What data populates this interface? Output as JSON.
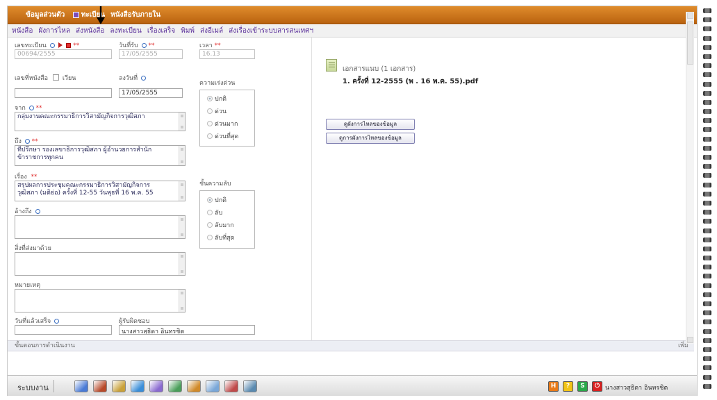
{
  "titlebar": {
    "part1": "ข้อมูลส่วนตัว",
    "part2": "ทะเบียน",
    "part3": "หนังสือรับภายใน"
  },
  "menu": [
    "หนังสือ",
    "ผังการไหล",
    "ส่งหนังสือ",
    "ลงทะเบียน",
    "เรื่องเสร็จ",
    "พิมพ์",
    "ส่งอีเมล์",
    "ส่งเรื่องเข้าระบบสารสนเทศฯ"
  ],
  "form": {
    "reg_no_label": "เลขทะเบียน",
    "reg_no_value": "00694/2555",
    "recv_date_label": "วันที่รับ",
    "recv_date_value": "17/05/2555",
    "time_label": "เวลา",
    "time_value": "16.13",
    "doc_no_label": "เลขที่หนังสือ",
    "circular_label": "เวียน",
    "date_label": "ลงวันที่",
    "date_value": "17/05/2555",
    "doc_no_value": "",
    "from_label": "จาก",
    "from_value": "กลุ่มงานคณะกรรมาธิการวิสามัญกิจการวุฒิสภา",
    "to_label": "ถึง",
    "to_line1": "ที่ปรึกษา รองเลขาธิการวุฒิสภา ผู้อำนวยการสำนัก",
    "to_line2": "ข้าราชการทุกคน",
    "subject_label": "เรื่อง",
    "subject_line1": "สรุปผลการประชุมคณะกรรมาธิการวิสามัญกิจการ",
    "subject_line2": "วุฒิสภา (มติย่อ) ครั้งที่ 12-55 วันพุธที่ 16 พ.ค. 55",
    "ref_label": "อ้างถึง",
    "enclosure_label": "สิ่งที่ส่งมาด้วย",
    "note_label": "หมายเหตุ",
    "done_date_label": "วันที่แล้วเสร็จ",
    "owner_label": "ผู้รับผิดชอบ",
    "owner_value": "นางสาวสุธิดา อินทรชิต"
  },
  "urgency": {
    "label": "ความเร่งด่วน",
    "options": [
      "ปกติ",
      "ด่วน",
      "ด่วนมาก",
      "ด่วนที่สุด"
    ],
    "selected": "ปกติ"
  },
  "secrecy": {
    "label": "ชั้นความลับ",
    "options": [
      "ปกติ",
      "ลับ",
      "ลับมาก",
      "ลับที่สุด"
    ],
    "selected": "ปกติ"
  },
  "attachments": {
    "header": "เอกสารแนบ (1 เอกสาร)",
    "file": "1. ครั้งที่ 12-2555 (พ . 16 พ.ค. 55).pdf"
  },
  "buttons": {
    "flow_view": "ดูผังการไหลของข้อมูล",
    "flow_print": "ดูการผังการไหลของข้อมูล"
  },
  "stepbar": {
    "label": "ขั้นตอนการดำเนินงาน",
    "add": "เพิ่ม"
  },
  "taskbar": {
    "system_label": "ระบบงาน",
    "user": "นางสาวสุธิดา อินทรชิต",
    "icons": [
      "edit-doc-icon",
      "books-icon",
      "pencil-book-icon",
      "doc-stack-icon",
      "printer-icon",
      "mail-send-icon",
      "people-search-icon",
      "checklist-icon",
      "users-icon",
      "user-profile-icon"
    ],
    "tray": [
      {
        "name": "settings-tray-icon",
        "glyph": "H",
        "color": "#e87a1a"
      },
      {
        "name": "help-tray-icon",
        "glyph": "?",
        "color": "#f2c416"
      },
      {
        "name": "switch-tray-icon",
        "glyph": "S",
        "color": "#2aa84a"
      },
      {
        "name": "power-tray-icon",
        "glyph": "⏻",
        "color": "#d82020"
      }
    ]
  }
}
